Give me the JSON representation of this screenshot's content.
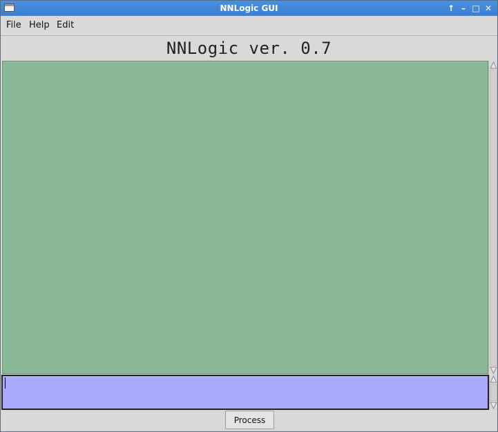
{
  "window": {
    "title": "NNLogic GUI",
    "controls": {
      "up": "↑",
      "minimize": "–",
      "maximize": "□",
      "close": "✕"
    }
  },
  "menubar": {
    "items": [
      "File",
      "Help",
      "Edit"
    ]
  },
  "header": {
    "title": "NNLogic ver. 0.7"
  },
  "output": {
    "background": "#8ab998",
    "text": ""
  },
  "input": {
    "background": "#aaaafc",
    "value": ""
  },
  "actions": {
    "process_label": "Process"
  }
}
